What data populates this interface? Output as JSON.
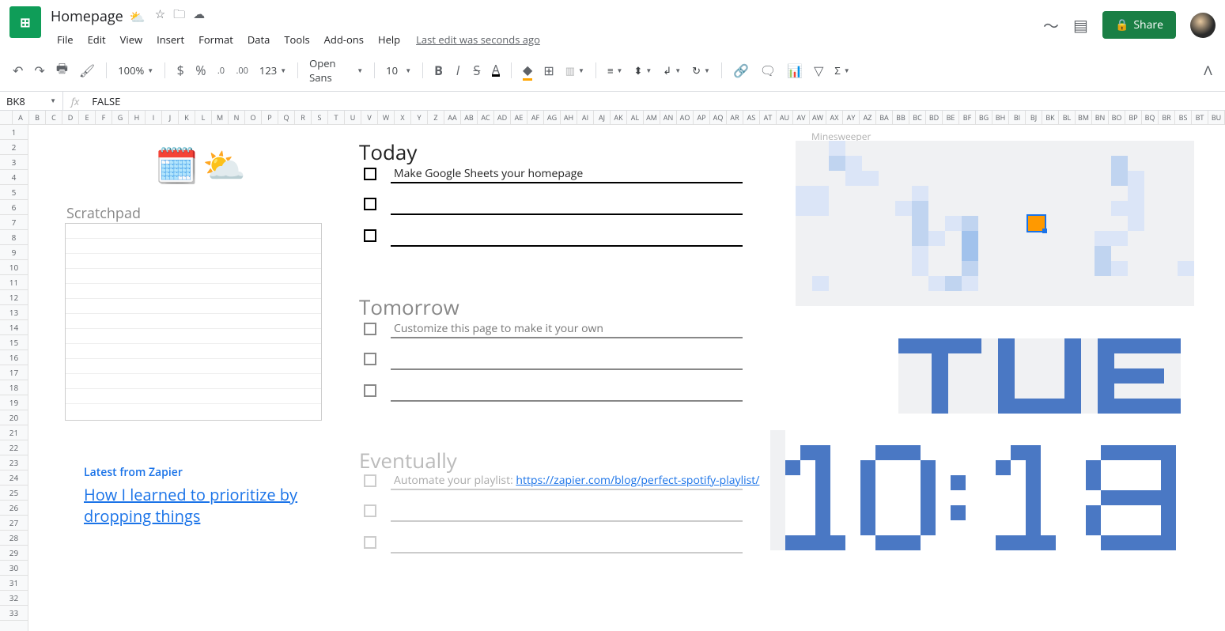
{
  "doc": {
    "title": "Homepage",
    "emoji": "⛅"
  },
  "menus": [
    "File",
    "Edit",
    "View",
    "Insert",
    "Format",
    "Data",
    "Tools",
    "Add-ons",
    "Help"
  ],
  "last_edit": "Last edit was seconds ago",
  "share": "Share",
  "toolbar": {
    "zoom": "100%",
    "font": "Open Sans",
    "size": "10",
    "currency": "$",
    "percent": "%",
    "dec_dec": ".0",
    "inc_dec": ".00",
    "num_fmt": "123"
  },
  "name_box": "BK8",
  "formula": "FALSE",
  "columns": [
    "A",
    "B",
    "C",
    "D",
    "E",
    "F",
    "G",
    "H",
    "I",
    "J",
    "K",
    "L",
    "M",
    "N",
    "O",
    "P",
    "Q",
    "R",
    "S",
    "T",
    "U",
    "V",
    "W",
    "X",
    "Y",
    "Z",
    "AA",
    "AB",
    "AC",
    "AD",
    "AE",
    "AF",
    "AG",
    "AH",
    "AI",
    "AJ",
    "AK",
    "AL",
    "AM",
    "AN",
    "AO",
    "AP",
    "AQ",
    "AR",
    "AS",
    "AT",
    "AU",
    "AV",
    "AW",
    "AX",
    "AY",
    "AZ",
    "BA",
    "BB",
    "BC",
    "BD",
    "BE",
    "BF",
    "BG",
    "BH",
    "BI",
    "BJ",
    "BK",
    "BL",
    "BM",
    "BN",
    "BO",
    "BP",
    "BQ",
    "BR",
    "BS",
    "BT",
    "BU"
  ],
  "rows": [
    "1",
    "2",
    "3",
    "4",
    "5",
    "6",
    "7",
    "8",
    "9",
    "10",
    "11",
    "12",
    "13",
    "14",
    "15",
    "16",
    "17",
    "18",
    "19",
    "20",
    "21",
    "22",
    "23",
    "24",
    "25",
    "26",
    "27",
    "28",
    "29",
    "30",
    "31",
    "32",
    "33"
  ],
  "scratchpad_label": "Scratchpad",
  "sections": {
    "today": "Today",
    "tomorrow": "Tomorrow",
    "eventually": "Eventually"
  },
  "tasks": {
    "today1": "Make Google Sheets your homepage",
    "tomorrow1": "Customize this page to make it your own",
    "eventually1_prefix": "Automate your playlist: ",
    "eventually1_link": "https://zapier.com/blog/perfect-spotify-playlist/"
  },
  "zapier": {
    "title": "Latest from Zapier",
    "article": "How I learned to prioritize by dropping things"
  },
  "minesweeper_label": "Minesweeper",
  "minesweeper": [
    [
      0,
      0,
      1,
      0,
      0,
      0,
      0,
      0,
      0,
      0,
      0,
      0,
      0,
      0,
      0,
      0,
      0,
      0,
      0,
      0,
      0,
      0,
      0,
      0
    ],
    [
      0,
      0,
      2,
      1,
      0,
      0,
      0,
      0,
      0,
      0,
      0,
      0,
      0,
      0,
      0,
      0,
      0,
      0,
      0,
      2,
      0,
      0,
      0,
      0
    ],
    [
      0,
      0,
      0,
      1,
      1,
      0,
      0,
      0,
      0,
      0,
      0,
      0,
      0,
      0,
      0,
      0,
      0,
      0,
      0,
      2,
      1,
      0,
      0,
      0
    ],
    [
      1,
      1,
      0,
      0,
      0,
      0,
      0,
      1,
      0,
      0,
      0,
      0,
      0,
      0,
      0,
      0,
      0,
      0,
      0,
      0,
      1,
      0,
      0,
      0
    ],
    [
      1,
      1,
      0,
      0,
      0,
      0,
      1,
      2,
      0,
      0,
      0,
      0,
      0,
      0,
      0,
      0,
      0,
      0,
      0,
      1,
      1,
      0,
      0,
      0
    ],
    [
      0,
      0,
      0,
      0,
      0,
      0,
      0,
      2,
      0,
      1,
      2,
      0,
      0,
      0,
      5,
      0,
      0,
      0,
      0,
      0,
      1,
      0,
      0,
      0
    ],
    [
      0,
      0,
      0,
      0,
      0,
      0,
      0,
      2,
      1,
      0,
      3,
      0,
      0,
      0,
      0,
      0,
      0,
      0,
      1,
      1,
      0,
      0,
      0,
      0
    ],
    [
      0,
      0,
      0,
      0,
      0,
      0,
      0,
      1,
      0,
      0,
      3,
      0,
      0,
      0,
      0,
      0,
      0,
      0,
      2,
      0,
      0,
      0,
      0,
      0
    ],
    [
      0,
      0,
      0,
      0,
      0,
      0,
      0,
      1,
      0,
      0,
      2,
      0,
      0,
      0,
      0,
      0,
      0,
      0,
      2,
      1,
      0,
      0,
      0,
      1
    ],
    [
      0,
      1,
      0,
      0,
      0,
      0,
      0,
      0,
      1,
      2,
      1,
      0,
      0,
      0,
      0,
      0,
      0,
      0,
      0,
      0,
      0,
      0,
      0,
      0
    ],
    [
      0,
      0,
      0,
      0,
      0,
      0,
      0,
      0,
      0,
      0,
      0,
      0,
      0,
      0,
      0,
      0,
      0,
      0,
      0,
      0,
      0,
      0,
      0,
      0
    ]
  ],
  "day_pixels": [
    [
      4,
      4,
      4,
      4,
      4,
      0,
      4,
      0,
      0,
      0,
      4,
      0,
      4,
      4,
      4,
      4,
      4
    ],
    [
      0,
      0,
      4,
      0,
      0,
      0,
      4,
      0,
      0,
      0,
      4,
      0,
      4,
      0,
      0,
      0,
      0
    ],
    [
      0,
      0,
      4,
      0,
      0,
      0,
      4,
      0,
      0,
      0,
      4,
      0,
      4,
      4,
      4,
      4,
      0
    ],
    [
      0,
      0,
      4,
      0,
      0,
      0,
      4,
      0,
      0,
      0,
      4,
      0,
      4,
      0,
      0,
      0,
      0
    ],
    [
      0,
      0,
      4,
      0,
      0,
      0,
      4,
      4,
      4,
      4,
      4,
      0,
      4,
      4,
      4,
      4,
      4
    ]
  ],
  "time_pixels": [
    [
      0,
      5,
      5,
      5,
      5,
      5,
      5,
      5,
      5,
      5,
      5,
      5,
      5,
      5,
      5,
      5,
      5,
      5,
      5,
      5,
      5,
      5,
      5,
      5,
      5,
      5,
      5,
      5
    ],
    [
      0,
      5,
      4,
      4,
      5,
      5,
      5,
      4,
      4,
      4,
      5,
      5,
      5,
      5,
      5,
      5,
      4,
      4,
      5,
      5,
      5,
      5,
      4,
      4,
      4,
      4,
      4,
      5
    ],
    [
      0,
      4,
      5,
      4,
      5,
      5,
      4,
      5,
      5,
      5,
      4,
      5,
      5,
      5,
      5,
      4,
      5,
      4,
      5,
      5,
      5,
      4,
      5,
      5,
      5,
      5,
      4,
      5
    ],
    [
      0,
      5,
      5,
      4,
      5,
      5,
      4,
      5,
      5,
      5,
      4,
      5,
      4,
      5,
      5,
      5,
      5,
      4,
      5,
      5,
      5,
      4,
      5,
      5,
      5,
      5,
      4,
      5
    ],
    [
      0,
      5,
      5,
      4,
      5,
      5,
      4,
      5,
      5,
      5,
      4,
      5,
      5,
      5,
      5,
      5,
      5,
      4,
      5,
      5,
      5,
      5,
      4,
      4,
      4,
      4,
      4,
      5
    ],
    [
      0,
      5,
      5,
      4,
      5,
      5,
      4,
      5,
      5,
      5,
      4,
      5,
      4,
      5,
      5,
      5,
      5,
      4,
      5,
      5,
      5,
      4,
      5,
      5,
      5,
      5,
      4,
      5
    ],
    [
      0,
      5,
      5,
      4,
      5,
      5,
      4,
      5,
      5,
      5,
      4,
      5,
      5,
      5,
      5,
      5,
      5,
      4,
      5,
      5,
      5,
      4,
      5,
      5,
      5,
      5,
      4,
      5
    ],
    [
      0,
      4,
      4,
      4,
      4,
      5,
      5,
      4,
      4,
      4,
      5,
      5,
      5,
      5,
      5,
      4,
      4,
      4,
      4,
      5,
      5,
      5,
      4,
      4,
      4,
      4,
      4,
      5
    ]
  ]
}
